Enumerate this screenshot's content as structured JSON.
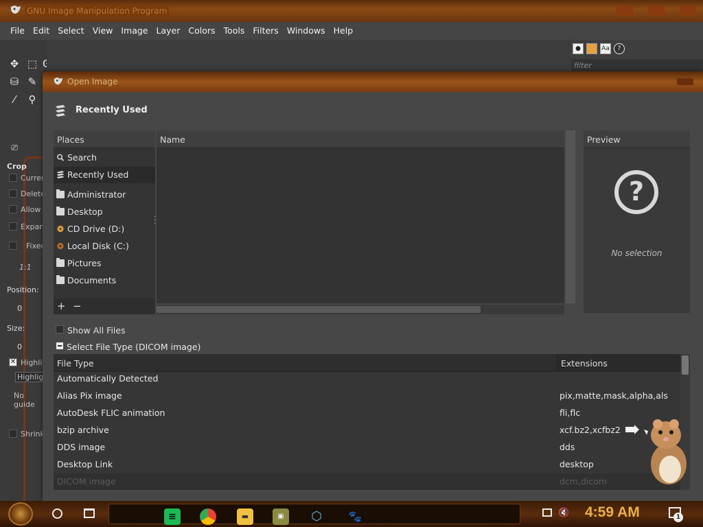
{
  "app": {
    "title": "GNU Image Manipulation Program",
    "menu": [
      "File",
      "Edit",
      "Select",
      "View",
      "Image",
      "Layer",
      "Colors",
      "Tools",
      "Filters",
      "Windows",
      "Help"
    ]
  },
  "tool_options": {
    "title": "Crop",
    "options": [
      "Curren",
      "Delete",
      "Allow",
      "Expan",
      "Fixed"
    ],
    "ratio": "1:1",
    "position_label": "Position:",
    "position_value": "0",
    "size_label": "Size:",
    "size_value": "0",
    "highlight": "Highli",
    "highlight_opacity": "Highlig",
    "guides": "No guide",
    "shrink": "Shrink"
  },
  "right_dock": {
    "filter_placeholder": "filter",
    "font_icon_text": "Aa"
  },
  "dialog": {
    "title": "Open Image",
    "location_title": "Recently Used",
    "places": {
      "header": "Places",
      "items": [
        {
          "label": "Search",
          "icon": "search-icon"
        },
        {
          "label": "Recently Used",
          "icon": "recent-icon",
          "selected": true
        },
        {
          "label": "Administrator",
          "icon": "folder-icon"
        },
        {
          "label": "Desktop",
          "icon": "folder-icon"
        },
        {
          "label": "CD Drive (D:)",
          "icon": "cd-drive-icon"
        },
        {
          "label": "Local Disk (C:)",
          "icon": "disk-icon"
        },
        {
          "label": "Pictures",
          "icon": "folder-icon"
        },
        {
          "label": "Documents",
          "icon": "folder-icon"
        }
      ],
      "add": "+",
      "remove": "−"
    },
    "files": {
      "header": "Name"
    },
    "preview": {
      "header": "Preview",
      "icon": "question-icon",
      "empty": "No selection"
    },
    "show_all_files": "Show All Files",
    "select_file_type": "Select File Type (DICOM image)",
    "file_types": {
      "col_type": "File Type",
      "col_ext": "Extensions",
      "rows": [
        {
          "type": "Automatically Detected",
          "ext": ""
        },
        {
          "type": "Alias Pix image",
          "ext": "pix,matte,mask,alpha,als"
        },
        {
          "type": "AutoDesk FLIC animation",
          "ext": "fli,flc"
        },
        {
          "type": "bzip archive",
          "ext": "xcf.bz2,xcfbz2"
        },
        {
          "type": "DDS image",
          "ext": "dds"
        },
        {
          "type": "Desktop Link",
          "ext": "desktop"
        },
        {
          "type": "DICOM image",
          "ext": "dcm,dicom",
          "dimmed": true
        }
      ]
    }
  },
  "taskbar": {
    "clock": "4:59 AM",
    "notification_count": "1",
    "apps": [
      "spotify-icon",
      "chrome-icon",
      "file-explorer-icon",
      "image-viewer-icon",
      "virtualbox-icon",
      "gimp-icon"
    ]
  },
  "colors": {
    "accent_rust": "#7a3412",
    "clock": "#e8b048"
  }
}
